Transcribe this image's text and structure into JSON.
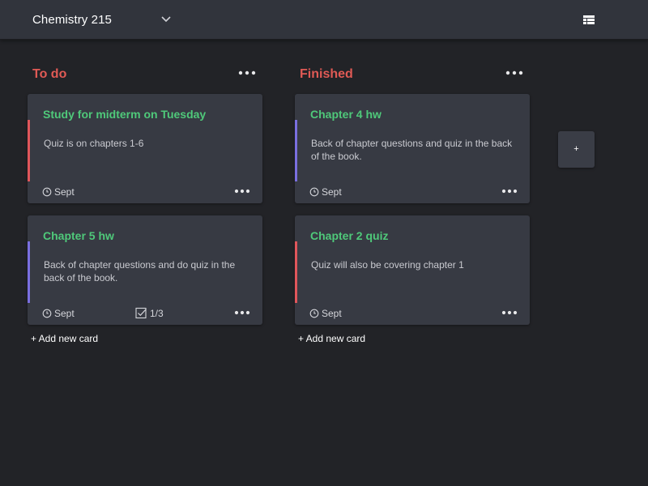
{
  "board": {
    "title": "Chemistry 215"
  },
  "colors": {
    "background": "#222327",
    "topbar": "#31343c",
    "card": "#373a43",
    "column_title": "#e05a55",
    "card_title": "#4fc97a",
    "stripe_red": "#e0565b",
    "stripe_purple": "#7a6fe0"
  },
  "icons": {
    "dropdown": "chevron-down-icon",
    "menu": "list-menu-icon",
    "more": "more-horizontal-icon",
    "clock": "clock-icon",
    "checklist": "checkbox-icon"
  },
  "columns": [
    {
      "title": "To do",
      "add_card_label": "+ Add new card",
      "cards": [
        {
          "title": "Study for midterm on Tuesday",
          "description": "Quiz is on chapters 1-6",
          "date": "Sept",
          "label_color": "#e0565b"
        },
        {
          "title": "Chapter 5 hw",
          "description": "Back of chapter questions and do quiz in the back of the book.",
          "date": "Sept",
          "checklist": "1/3",
          "label_color": "#7a6fe0"
        }
      ]
    },
    {
      "title": "Finished",
      "add_card_label": "+ Add new card",
      "cards": [
        {
          "title": "Chapter 4 hw",
          "description": "Back of chapter questions and quiz in the back of the book.",
          "date": "Sept",
          "label_color": "#7a6fe0"
        },
        {
          "title": "Chapter 2 quiz",
          "description": "Quiz will also be covering chapter 1",
          "date": "Sept",
          "label_color": "#e0565b"
        }
      ]
    }
  ],
  "add_column_label": "+"
}
